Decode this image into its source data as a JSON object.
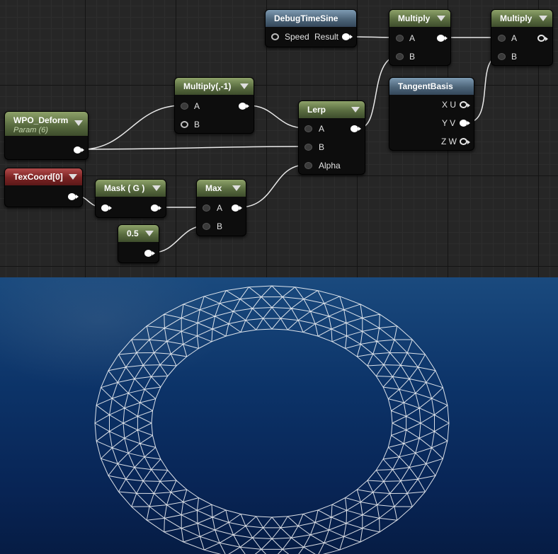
{
  "graph": {
    "nodes": {
      "debug_time_sine": {
        "title": "DebugTimeSine",
        "pin_speed": "Speed",
        "pin_result": "Result"
      },
      "multiply_1": {
        "title": "Multiply",
        "pin_a": "A",
        "pin_b": "B"
      },
      "multiply_2": {
        "title": "Multiply",
        "pin_a": "A",
        "pin_b": "B"
      },
      "multiply_neg1": {
        "title": "Multiply(,-1)",
        "pin_a": "A",
        "pin_b": "B"
      },
      "tangent_basis": {
        "title": "TangentBasis",
        "pin_xu": "X U",
        "pin_yv": "Y V",
        "pin_zw": "Z W"
      },
      "lerp": {
        "title": "Lerp",
        "pin_a": "A",
        "pin_b": "B",
        "pin_alpha": "Alpha"
      },
      "wpo_deform": {
        "title": "WPO_Deform",
        "subtitle": "Param (6)"
      },
      "texcoord": {
        "title": "TexCoord[0]"
      },
      "mask": {
        "title": "Mask ( G )"
      },
      "max": {
        "title": "Max",
        "pin_a": "A",
        "pin_b": "B"
      },
      "const": {
        "title": "0.5"
      }
    }
  },
  "colors": {
    "param_header": "#5a6d41",
    "function_header": "#4d6579",
    "texcoord_header": "#7a2323",
    "wire": "#ffffff",
    "viewport_bg": "#0c3368",
    "mesh_wire": "#ffffff"
  }
}
